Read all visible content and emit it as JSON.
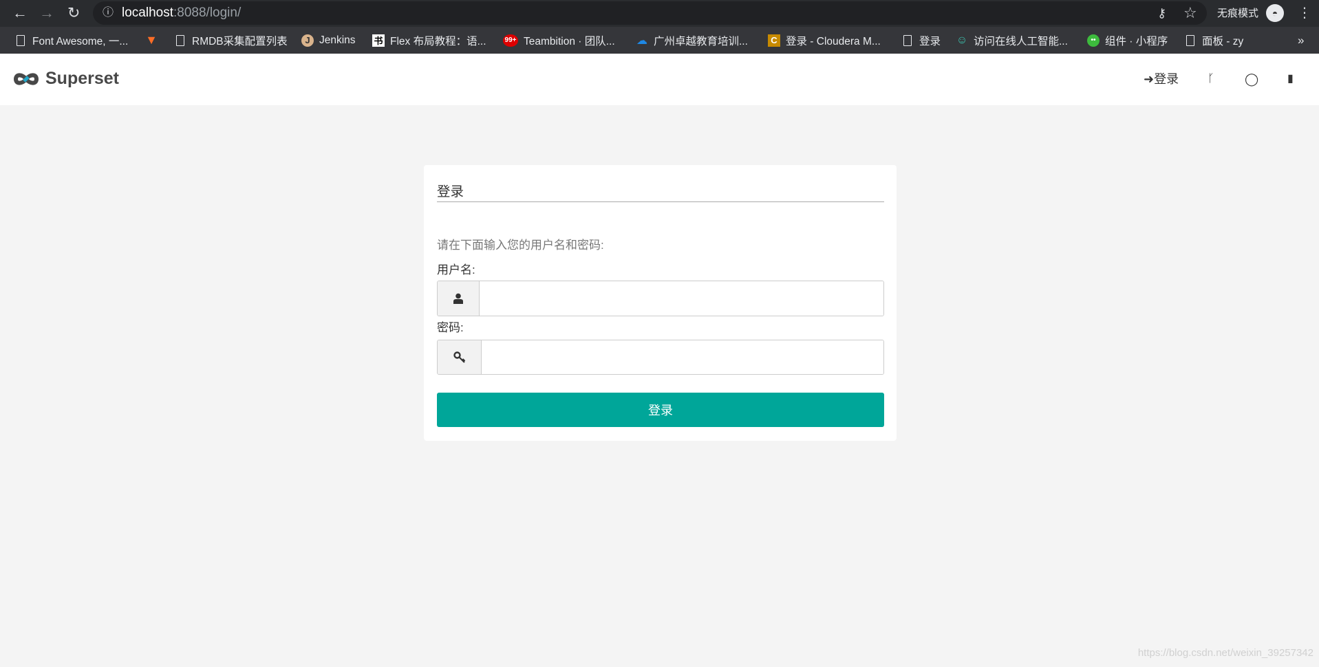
{
  "browser": {
    "url_host": "localhost",
    "url_rest": ":8088/login/",
    "incognito_label": "无痕模式",
    "bookmarks": [
      {
        "label": "Font Awesome, 一...",
        "icon": "document-icon"
      },
      {
        "label": "",
        "icon": "gitlab-icon"
      },
      {
        "label": "RMDB采集配置列表",
        "icon": "document-icon"
      },
      {
        "label": "Jenkins",
        "icon": "jenkins-icon"
      },
      {
        "label": "Flex 布局教程：语...",
        "icon": "flex-icon"
      },
      {
        "label": "Teambition · 团队...",
        "icon": "teambition-icon"
      },
      {
        "label": "广州卓越教育培训...",
        "icon": "cloud-icon"
      },
      {
        "label": "登录 - Cloudera M...",
        "icon": "cloudera-icon"
      },
      {
        "label": "登录",
        "icon": "document-icon"
      },
      {
        "label": "访问在线人工智能...",
        "icon": "robot-icon"
      },
      {
        "label": "组件 · 小程序",
        "icon": "wechat-icon"
      },
      {
        "label": "面板 - zy",
        "icon": "document-icon"
      }
    ],
    "more": "»"
  },
  "navbar": {
    "brand": "Superset",
    "login_label": "登录"
  },
  "login": {
    "title": "登录",
    "hint": "请在下面输入您的用户名和密码:",
    "username_label": "用户名:",
    "username_value": "",
    "password_label": "密码:",
    "password_value": "",
    "submit_label": "登录"
  },
  "colors": {
    "accent": "#00a699",
    "background": "#f4f4f4"
  },
  "watermark": "https://blog.csdn.net/weixin_39257342"
}
